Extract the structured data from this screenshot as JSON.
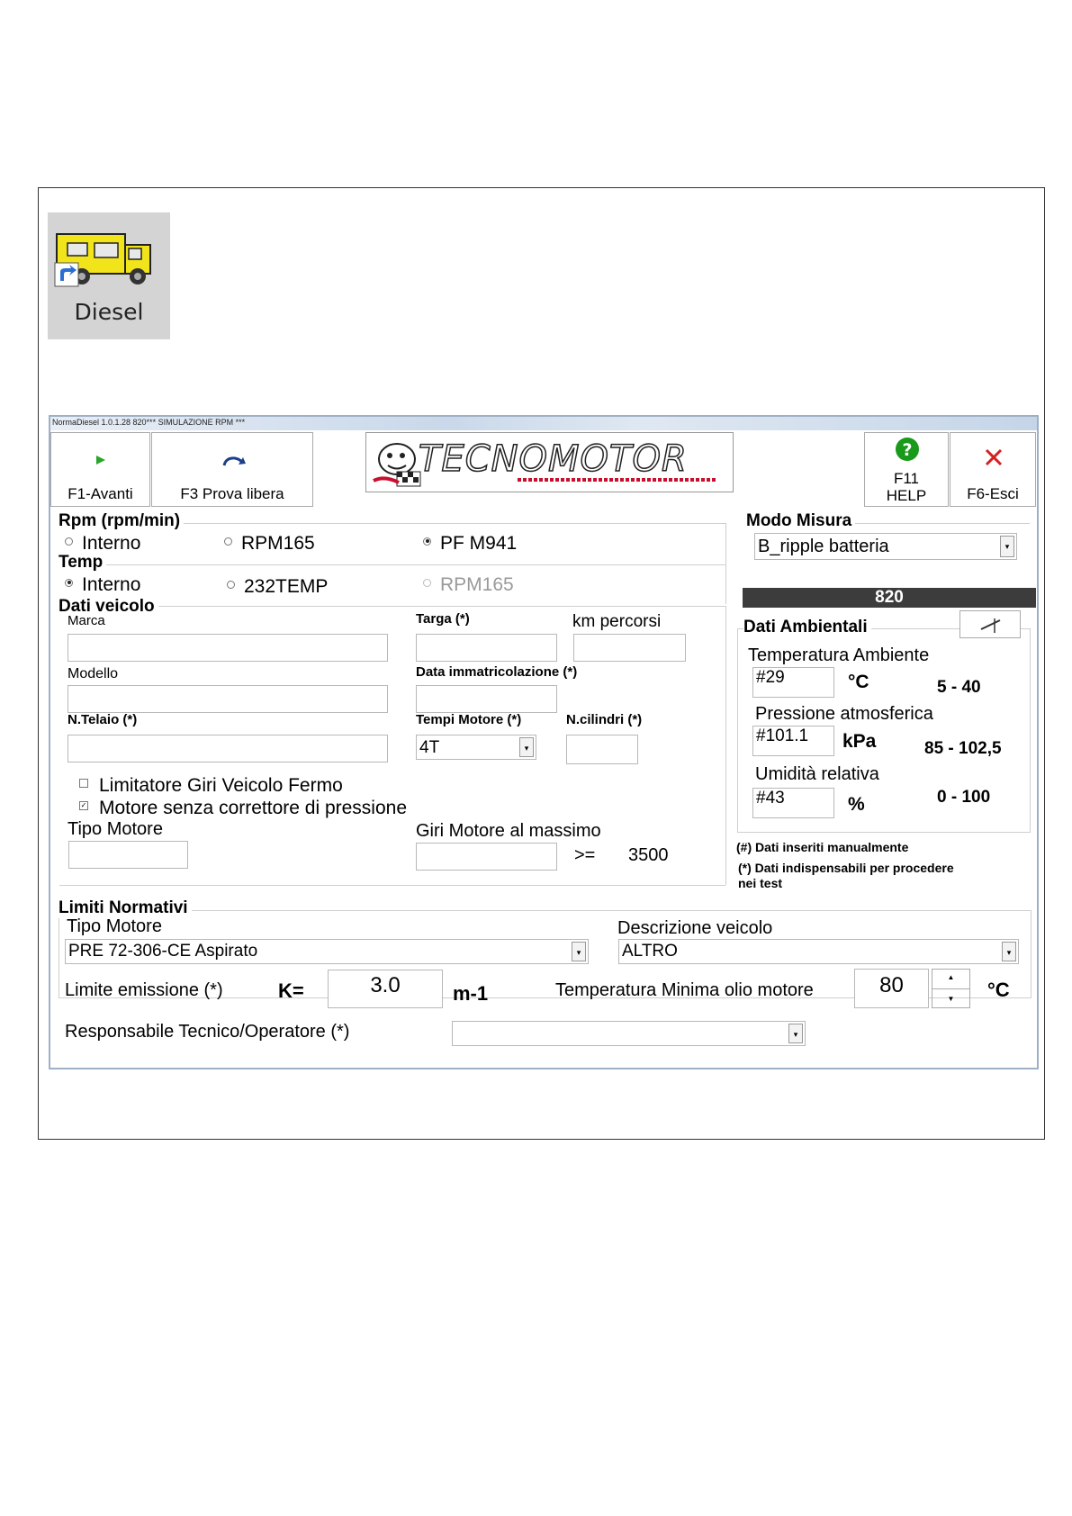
{
  "desktop": {
    "icon_label": "Diesel"
  },
  "window": {
    "title": "NormaDiesel 1.0.1.28 820*** SIMULAZIONE RPM ***"
  },
  "toolbar": {
    "forward_label": "F1-Avanti",
    "free_test_label": "F3 Prova libera",
    "help_label_line1": "F11",
    "help_label_line2": "HELP",
    "exit_label": "F6-Esci",
    "logo_text": "TECNOMOTOR"
  },
  "rpm": {
    "title": "Rpm (rpm/min)",
    "options": [
      "Interno",
      "RPM165",
      "PF M941"
    ],
    "selected": "PF M941"
  },
  "temp": {
    "title": "Temp",
    "options": [
      "Interno",
      "232TEMP",
      "RPM165"
    ],
    "selected": "Interno"
  },
  "modo_misura": {
    "title": "Modo Misura",
    "value": "B_ripple batteria"
  },
  "device_bar": {
    "value": "820"
  },
  "vehicle": {
    "title": "Dati veicolo",
    "marca_label": "Marca",
    "marca_value": "",
    "targa_label": "Targa (*)",
    "targa_value": "",
    "km_label": "km percorsi",
    "km_value": "",
    "modello_label": "Modello",
    "modello_value": "",
    "data_label": "Data immatricolazione (*)",
    "data_value": "",
    "telaio_label": "N.Telaio (*)",
    "telaio_value": "",
    "tempi_label": "Tempi Motore (*)",
    "tempi_value": "4T",
    "cilindri_label": "N.cilindri (*)",
    "cilindri_value": "",
    "limitatore_label": "Limitatore Giri Veicolo Fermo",
    "limitatore_checked": false,
    "correttore_label": "Motore senza correttore di pressione",
    "correttore_checked": true,
    "tipo_motore_label": "Tipo Motore",
    "tipo_motore_value": "",
    "giri_label": "Giri Motore al massimo",
    "giri_value": "",
    "giri_op": ">=",
    "giri_min": "3500"
  },
  "ambient": {
    "title": "Dati Ambientali",
    "temp_label": "Temperatura Ambiente",
    "temp_value": "#29",
    "temp_unit": "°C",
    "temp_range": "5 - 40",
    "press_label": "Pressione atmosferica",
    "press_value": "#101.1",
    "press_unit": "kPa",
    "press_range": "85 - 102,5",
    "hum_label": "Umidità relativa",
    "hum_value": "#43",
    "hum_unit": "%",
    "hum_range": "0 - 100",
    "note1": "(#) Dati inseriti manualmente",
    "note2_line1": "(*) Dati indispensabili per procedere",
    "note2_line2": "nei test"
  },
  "limits": {
    "title": "Limiti Normativi",
    "tipo_label": "Tipo Motore",
    "tipo_value": "PRE 72-306-CE Aspirato",
    "desc_label": "Descrizione veicolo",
    "desc_value": "ALTRO",
    "emission_label": "Limite emissione (*)",
    "k_label": "K=",
    "k_value": "3.0",
    "k_unit": "m-1",
    "oil_label": "Temperatura Minima olio motore",
    "oil_value": "80",
    "oil_unit": "°C",
    "operator_label": "Responsabile Tecnico/Operatore (*)",
    "operator_value": ""
  },
  "colors": {
    "device_bar": "#3c3c3c",
    "icon_bg": "#d4d4d4",
    "help_green": "#1a9a1a",
    "exit_red": "#d42020"
  }
}
